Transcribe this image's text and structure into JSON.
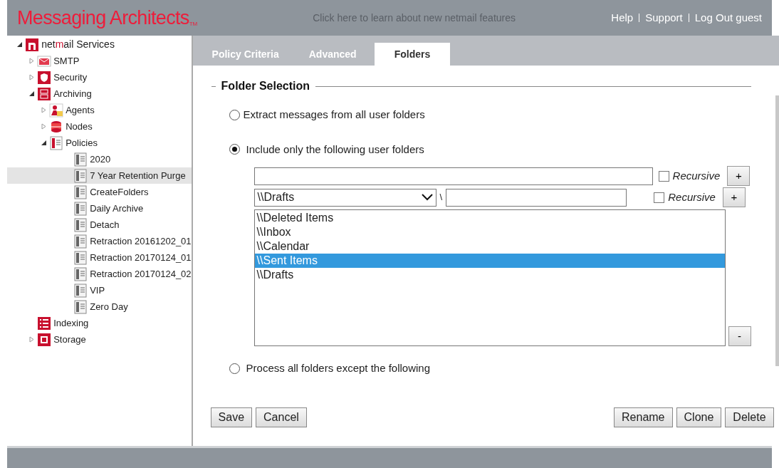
{
  "header": {
    "brand": "Messaging Architects",
    "trademark": "TM",
    "banner_link": "Click here to learn about new netmail features",
    "links": [
      "Help",
      "Support",
      "Log Out guest"
    ]
  },
  "tree": [
    {
      "label_parts": [
        {
          "text": "net",
          "accent": false
        },
        {
          "text": "m",
          "accent": true
        },
        {
          "text": "ail Services",
          "accent": false
        }
      ],
      "kind": "service",
      "expanded": true,
      "selected": false,
      "children": [
        {
          "label": "SMTP",
          "kind": "smtp",
          "expanded": false,
          "selected": false
        },
        {
          "label": "Security",
          "kind": "security",
          "expanded": false,
          "selected": false
        },
        {
          "label": "Archiving",
          "kind": "archiving",
          "expanded": true,
          "selected": false,
          "children": [
            {
              "label": "Agents",
              "kind": "agents",
              "expanded": false,
              "selected": false
            },
            {
              "label": "Nodes",
              "kind": "nodes",
              "expanded": false,
              "selected": false
            },
            {
              "label": "Policies",
              "kind": "policies",
              "expanded": true,
              "selected": false,
              "children": [
                {
                  "label": "2020",
                  "kind": "policy",
                  "selected": false
                },
                {
                  "label": "7 Year Retention Purge",
                  "kind": "policy",
                  "selected": true
                },
                {
                  "label": "CreateFolders",
                  "kind": "policy",
                  "selected": false
                },
                {
                  "label": "Daily Archive",
                  "kind": "policy",
                  "selected": false
                },
                {
                  "label": "Detach",
                  "kind": "policy",
                  "selected": false
                },
                {
                  "label": "Retraction 20161202_01",
                  "kind": "policy",
                  "selected": false
                },
                {
                  "label": "Retraction 20170124_01",
                  "kind": "policy",
                  "selected": false
                },
                {
                  "label": "Retraction 20170124_02",
                  "kind": "policy",
                  "selected": false
                },
                {
                  "label": "VIP",
                  "kind": "policy",
                  "selected": false
                },
                {
                  "label": "Zero Day",
                  "kind": "policy",
                  "selected": false
                }
              ]
            }
          ]
        },
        {
          "label": "Indexing",
          "kind": "indexing",
          "selected": false
        },
        {
          "label": "Storage",
          "kind": "storage",
          "expanded": false,
          "selected": false
        }
      ]
    }
  ],
  "tabs": [
    {
      "label": "Policy Criteria",
      "selected": false
    },
    {
      "label": "Advanced",
      "selected": false
    },
    {
      "label": "Folders",
      "selected": true
    }
  ],
  "section_title": "Folder Selection",
  "options": [
    {
      "label": "Extract messages from all user folders",
      "selected": false
    },
    {
      "label": "Include only the following user folders",
      "selected": true
    },
    {
      "label": "Process all folders except the following",
      "selected": false
    }
  ],
  "folder_inputs": {
    "recursive_rows": [
      {
        "label": "Recursive",
        "checked": false,
        "add": "+"
      },
      {
        "label": "Recursive",
        "checked": false,
        "add": "+"
      }
    ],
    "dropdown_value": "\\\\Drafts",
    "separator": "\\",
    "remove": "-"
  },
  "folder_list": [
    {
      "label": "\\\\Deleted Items",
      "selected": false
    },
    {
      "label": "\\\\Inbox",
      "selected": false
    },
    {
      "label": "\\\\Calendar",
      "selected": false
    },
    {
      "label": "\\\\Sent Items",
      "selected": true
    },
    {
      "label": "\\\\Drafts",
      "selected": false
    }
  ],
  "buttons_left": [
    "Save",
    "Cancel"
  ],
  "buttons_right": [
    "Rename",
    "Clone",
    "Delete"
  ]
}
